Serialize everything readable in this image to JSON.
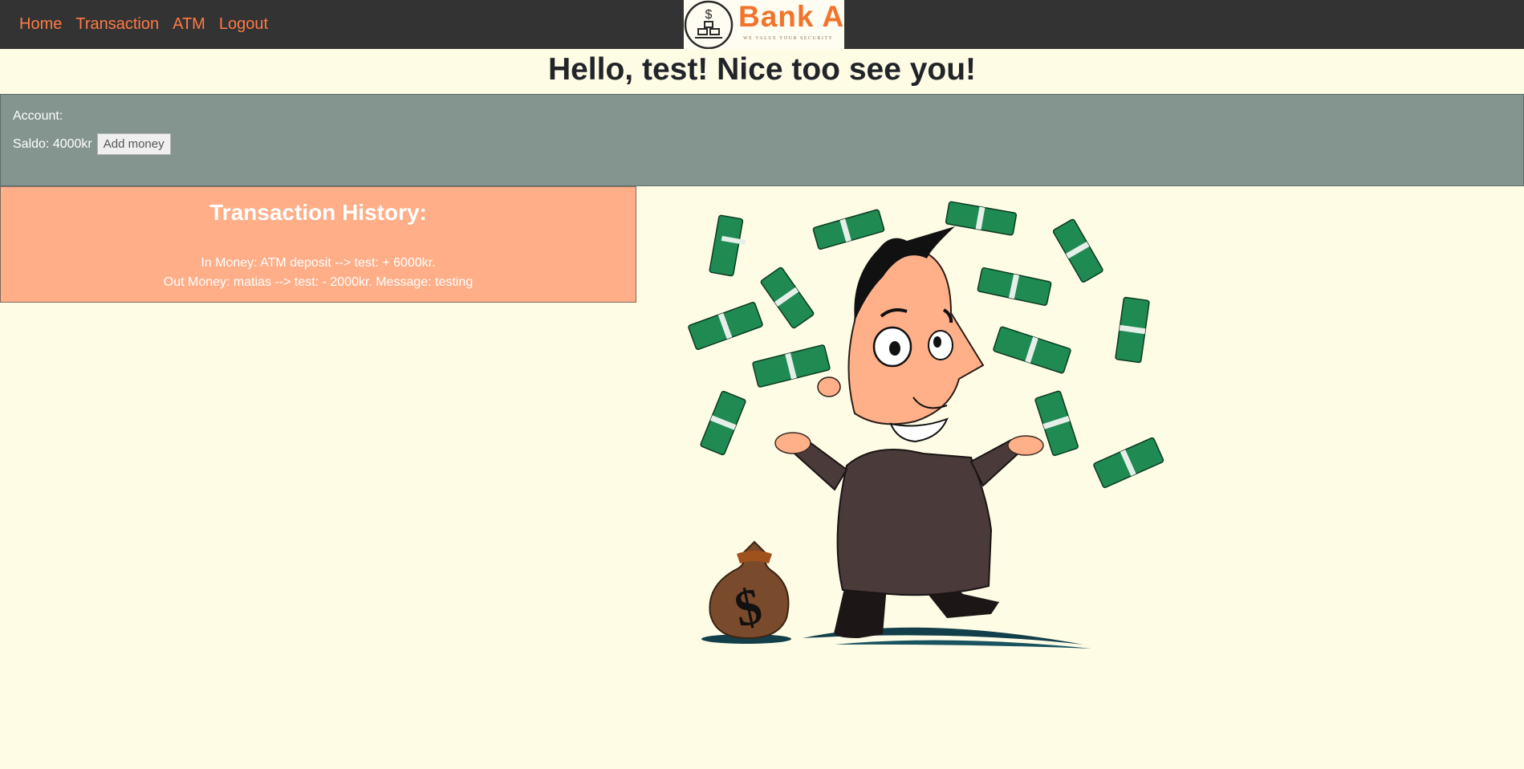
{
  "navbar": {
    "links": [
      {
        "label": "Home"
      },
      {
        "label": "Transaction"
      },
      {
        "label": "ATM"
      },
      {
        "label": "Logout"
      }
    ],
    "logo": {
      "text": "Bank A",
      "tagline": "WE VALUE YOUR SECURITY",
      "icon": "dollar-gold-bars-icon"
    }
  },
  "greeting": "Hello, test! Nice too see you!",
  "account": {
    "label": "Account:",
    "saldo": "Saldo: 4000kr",
    "add_money_label": "Add money"
  },
  "history": {
    "title": "Transaction History:",
    "entries": [
      "In Money: ATM deposit --> test: + 6000kr.",
      "Out Money: matias --> test: - 2000kr. Message: testing"
    ]
  },
  "illustration": {
    "icon": "man-with-money-illustration"
  },
  "colors": {
    "navbar_bg": "#333333",
    "nav_link": "#ff7b45",
    "page_bg": "#fffce6",
    "account_bg": "#83958e",
    "history_bg": "#ffae88",
    "logo_orange": "#f2742c"
  }
}
